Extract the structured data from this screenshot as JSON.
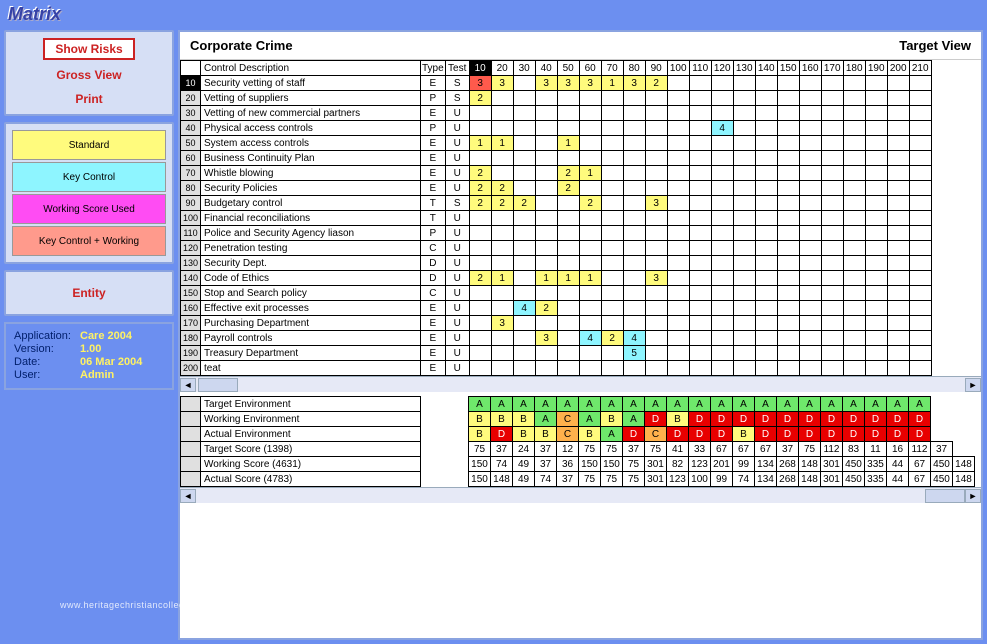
{
  "app_title": "Matrix",
  "sidebar": {
    "show_risks": "Show Risks",
    "gross_view": "Gross View",
    "print": "Print",
    "entity": "Entity"
  },
  "legend": [
    {
      "label": "Standard",
      "bg": "#fffb7d"
    },
    {
      "label": "Key Control",
      "bg": "#8ef5ff"
    },
    {
      "label": "Working Score Used",
      "bg": "#ff4cf3"
    },
    {
      "label": "Key Control\n+\nWorking",
      "bg": "#ff9a8c"
    }
  ],
  "info": {
    "application_label": "Application:",
    "application": "Care 2004",
    "version_label": "Version:",
    "version": "1.00",
    "date_label": "Date:",
    "date": "06 Mar 2004",
    "user_label": "User:",
    "user": "Admin"
  },
  "main": {
    "title": "Corporate Crime",
    "view": "Target View",
    "columns": {
      "rownum": "",
      "desc": "Control Description",
      "type": "Type",
      "test": "Test",
      "bins": [
        "10",
        "20",
        "30",
        "40",
        "50",
        "60",
        "70",
        "80",
        "90",
        "100",
        "110",
        "120",
        "130",
        "140",
        "150",
        "160",
        "170",
        "180",
        "190",
        "200",
        "210"
      ]
    },
    "rows": [
      {
        "n": "10",
        "sel": true,
        "desc": "Security vetting of staff",
        "type": "E",
        "test": "S",
        "cells": {
          "10": "3r",
          "20": "3y",
          "40": "3y",
          "50": "3y",
          "60": "3y",
          "70": "1y",
          "80": "3y",
          "90": "2y"
        }
      },
      {
        "n": "20",
        "desc": "Vetting of suppliers",
        "type": "P",
        "test": "S",
        "cells": {
          "10": "2y"
        }
      },
      {
        "n": "30",
        "desc": "Vetting of new commercial partners",
        "type": "E",
        "test": "U",
        "cells": {}
      },
      {
        "n": "40",
        "desc": "Physical access controls",
        "type": "P",
        "test": "U",
        "cells": {
          "120": "4c"
        }
      },
      {
        "n": "50",
        "desc": "System access controls",
        "type": "E",
        "test": "U",
        "cells": {
          "10": "1y",
          "20": "1y",
          "50": "1y"
        }
      },
      {
        "n": "60",
        "desc": "Business Continuity Plan",
        "type": "E",
        "test": "U",
        "cells": {}
      },
      {
        "n": "70",
        "desc": "Whistle blowing",
        "type": "E",
        "test": "U",
        "cells": {
          "10": "2y",
          "50": "2y",
          "60": "1y"
        }
      },
      {
        "n": "80",
        "desc": "Security Policies",
        "type": "E",
        "test": "U",
        "cells": {
          "10": "2y",
          "20": "2y",
          "50": "2y"
        }
      },
      {
        "n": "90",
        "desc": "Budgetary control",
        "type": "T",
        "test": "S",
        "cells": {
          "10": "2y",
          "20": "2y",
          "30": "2y",
          "60": "2y",
          "90": "3y"
        }
      },
      {
        "n": "100",
        "desc": "Financial reconciliations",
        "type": "T",
        "test": "U",
        "cells": {}
      },
      {
        "n": "110",
        "desc": "Police and Security Agency liason",
        "type": "P",
        "test": "U",
        "cells": {}
      },
      {
        "n": "120",
        "desc": "Penetration testing",
        "type": "C",
        "test": "U",
        "cells": {}
      },
      {
        "n": "130",
        "desc": "Security Dept.",
        "type": "D",
        "test": "U",
        "cells": {}
      },
      {
        "n": "140",
        "desc": "Code of Ethics",
        "type": "D",
        "test": "U",
        "cells": {
          "10": "2y",
          "20": "1y",
          "40": "1y",
          "50": "1y",
          "60": "1y",
          "90": "3y"
        }
      },
      {
        "n": "150",
        "desc": "Stop and Search policy",
        "type": "C",
        "test": "U",
        "cells": {}
      },
      {
        "n": "160",
        "desc": "Effective exit processes",
        "type": "E",
        "test": "U",
        "cells": {
          "30": "4c",
          "40": "2y"
        }
      },
      {
        "n": "170",
        "desc": "Purchasing Department",
        "type": "E",
        "test": "U",
        "cells": {
          "20": "3y"
        }
      },
      {
        "n": "180",
        "desc": "Payroll controls",
        "type": "E",
        "test": "U",
        "cells": {
          "40": "3y",
          "60": "4c",
          "70": "2y",
          "80": "4c"
        }
      },
      {
        "n": "190",
        "desc": "Treasury Department",
        "type": "E",
        "test": "U",
        "cells": {
          "80": "5c"
        }
      },
      {
        "n": "200",
        "desc": "teat",
        "type": "E",
        "test": "U",
        "cells": {}
      }
    ],
    "summary_rows": [
      {
        "label": "Target Environment",
        "vals": [
          "A",
          "A",
          "A",
          "A",
          "A",
          "A",
          "A",
          "A",
          "A",
          "A",
          "A",
          "A",
          "A",
          "A",
          "A",
          "A",
          "A",
          "A",
          "A",
          "A",
          "A"
        ],
        "styles": [
          "g",
          "g",
          "g",
          "g",
          "g",
          "g",
          "g",
          "g",
          "g",
          "g",
          "g",
          "g",
          "g",
          "g",
          "g",
          "g",
          "g",
          "g",
          "g",
          "g",
          "g"
        ]
      },
      {
        "label": "Working Environment",
        "vals": [
          "B",
          "B",
          "B",
          "A",
          "C",
          "A",
          "B",
          "A",
          "D",
          "B",
          "D",
          "D",
          "D",
          "D",
          "D",
          "D",
          "D",
          "D",
          "D",
          "D",
          "D"
        ],
        "styles": [
          "y",
          "y",
          "y",
          "g",
          "o",
          "g",
          "y",
          "g",
          "dr",
          "y",
          "dr",
          "dr",
          "dr",
          "dr",
          "dr",
          "dr",
          "dr",
          "dr",
          "dr",
          "dr",
          "dr"
        ]
      },
      {
        "label": "Actual Environment",
        "vals": [
          "B",
          "D",
          "B",
          "B",
          "C",
          "B",
          "A",
          "D",
          "C",
          "D",
          "D",
          "D",
          "B",
          "D",
          "D",
          "D",
          "D",
          "D",
          "D",
          "D",
          "D"
        ],
        "styles": [
          "y",
          "dr",
          "y",
          "y",
          "o",
          "y",
          "g",
          "dr",
          "o",
          "dr",
          "dr",
          "dr",
          "y",
          "dr",
          "dr",
          "dr",
          "dr",
          "dr",
          "dr",
          "dr",
          "dr"
        ]
      },
      {
        "label": "Target Score   (1398)",
        "vals": [
          "75",
          "37",
          "24",
          "37",
          "12",
          "75",
          "75",
          "37",
          "75",
          "41",
          "33",
          "67",
          "67",
          "67",
          "37",
          "75",
          "112",
          "83",
          "11",
          "16",
          "112",
          "37"
        ],
        "styles": []
      },
      {
        "label": "Working Score (4631)",
        "vals": [
          "150",
          "74",
          "49",
          "37",
          "36",
          "150",
          "150",
          "75",
          "301",
          "82",
          "123",
          "201",
          "99",
          "134",
          "268",
          "148",
          "301",
          "450",
          "335",
          "44",
          "67",
          "450",
          "148"
        ],
        "styles": []
      },
      {
        "label": "Actual Score   (4783)",
        "vals": [
          "150",
          "148",
          "49",
          "74",
          "37",
          "75",
          "75",
          "75",
          "301",
          "123",
          "100",
          "99",
          "74",
          "134",
          "268",
          "148",
          "301",
          "450",
          "335",
          "44",
          "67",
          "450",
          "148"
        ],
        "styles": []
      }
    ]
  },
  "watermark": "www.heritagechristiancollege.com"
}
